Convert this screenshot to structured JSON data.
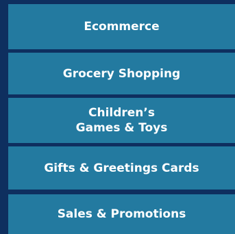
{
  "menu": {
    "items": [
      {
        "label": "Ecommerce"
      },
      {
        "label": "Grocery Shopping"
      },
      {
        "label": "Children’s\nGames & Toys"
      },
      {
        "label": "Gifts & Greetings Cards"
      },
      {
        "label": "Sales & Promotions"
      }
    ]
  },
  "colors": {
    "background": "#0e2f5f",
    "item_background": "#237aa0",
    "text": "#ffffff"
  }
}
